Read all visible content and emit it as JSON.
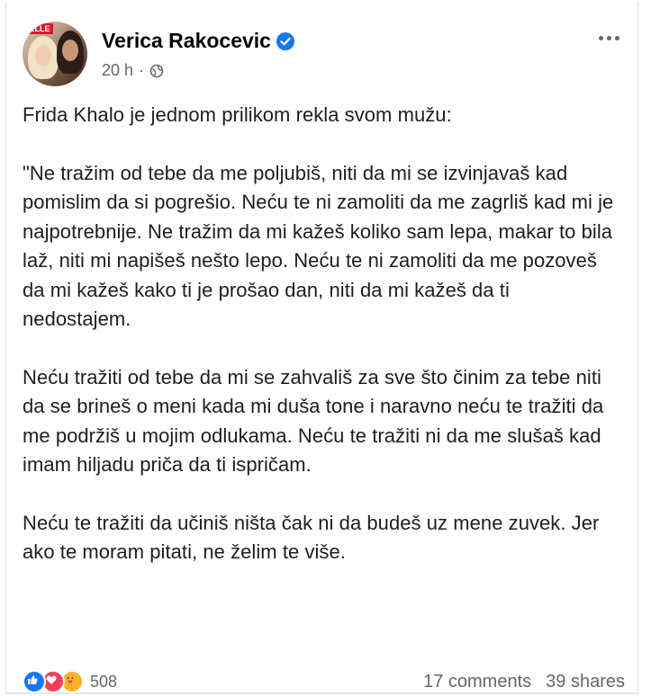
{
  "post": {
    "author": "Verica Rakocevic",
    "avatar_logo": "ELLE",
    "time": "20 h",
    "separator": "·",
    "paragraphs": [
      "Frida Khalo je jednom prilikom rekla svom mužu:",
      "\"Ne tražim od tebe da me poljubiš, niti da mi se izvinjavaš kad pomislim da si pogrešio. Neću te ni zamoliti da me zagrliš kad mi je najpotrebnije. Ne tražim da mi kažeš koliko sam lepa, makar to bila laž, niti mi napišeš nešto lepo. Neću te ni zamoliti da me pozoveš da mi kažeš kako ti je prošao dan, niti da mi kažeš da ti nedostajem.",
      "Neću tražiti od tebe da mi se zahvališ za sve što činim za tebe niti da se brineš o meni kada mi duša tone i naravno neću te tražiti da me podržiš u mojim odlukama. Neću te tražiti ni da me slušaš kad imam hiljadu priča da ti ispričam.",
      "Neću te tražiti da učiniš ništa čak ni da budeš uz mene zuvek. Jer ako te moram pitati, ne želim te više."
    ]
  },
  "footer": {
    "reaction_count": "508",
    "comments": "17 comments",
    "shares": "39 shares"
  },
  "icons": {
    "verified": "verified-badge-icon",
    "audience": "globe-icon",
    "more": "more-options-icon",
    "reactions": [
      "like-icon",
      "love-icon",
      "care-icon"
    ]
  },
  "colors": {
    "accent": "#1877f2",
    "love": "#f33e58",
    "care": "#f7b125",
    "secondary_text": "#65676b"
  }
}
